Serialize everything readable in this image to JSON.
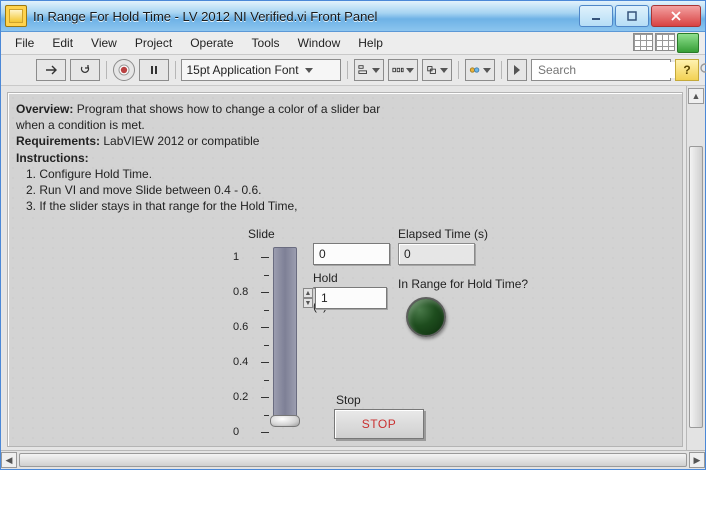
{
  "window": {
    "title": "In Range For Hold Time - LV 2012 NI Verified.vi Front Panel"
  },
  "menu": {
    "items": [
      "File",
      "Edit",
      "View",
      "Project",
      "Operate",
      "Tools",
      "Window",
      "Help"
    ]
  },
  "toolbar": {
    "font_label": "15pt Application Font",
    "search_placeholder": "Search"
  },
  "desc": {
    "overview_label": "Overview:",
    "overview_text": "Program that shows how to change a color of a slider bar",
    "overview_text2": "when a condition is met.",
    "req_label": "Requirements:",
    "req_text": "LabVIEW 2012 or compatible",
    "instr_label": "Instructions:",
    "instr_1": "1. Configure Hold Time.",
    "instr_2": "2. Run VI and move Slide between 0.4 - 0.6.",
    "instr_3": "3. If the slider stays in that range for the Hold Time,"
  },
  "controls": {
    "slide_label": "Slide",
    "slide_value": "0",
    "slide_scale": [
      "1",
      "0.8",
      "0.6",
      "0.4",
      "0.2",
      "0"
    ],
    "hold_label": "Hold Time (s)",
    "hold_value": "1",
    "elapsed_label": "Elapsed Time (s)",
    "elapsed_value": "0",
    "inrange_label": "In Range for Hold Time?",
    "stop_caption": "Stop",
    "stop_label": "STOP"
  }
}
